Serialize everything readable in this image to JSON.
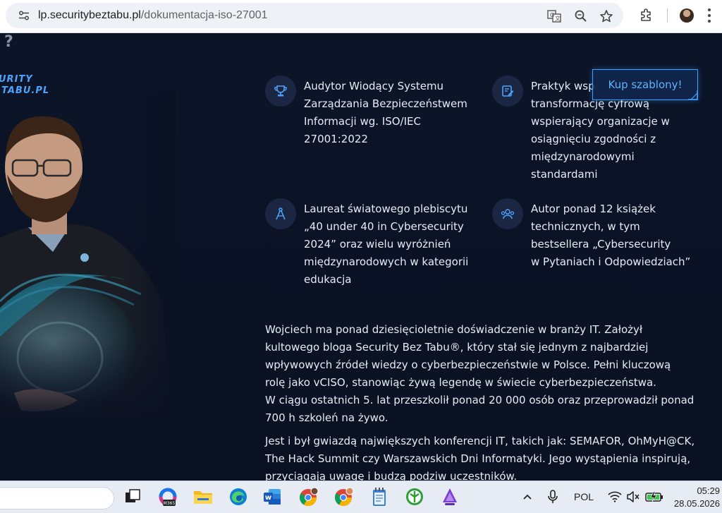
{
  "browser": {
    "url_host": "lp.securitybeztabu.pl",
    "url_path": "/dokumentacja-iso-27001",
    "icons": [
      "site-info-icon",
      "translate-icon",
      "zoom-icon",
      "bookmark-star-icon",
      "extensions-icon",
      "profile-avatar",
      "menu-kebab-icon"
    ]
  },
  "page": {
    "brand_line1": "URITY",
    "brand_line2": "TABU.PL",
    "cta_label": "Kup szablony!",
    "features": [
      {
        "icon": "trophy-icon",
        "text": "Audytor Wiodący Systemu\nZarządzania Bezpieczeństwem\nInformacji wg. ISO/IEC\n27001:2022"
      },
      {
        "icon": "document-edit-icon",
        "text": "Praktyk wsp\ntransformację cyfrową\nwspierający organizacje w\nosiągnięciu zgodności z\nmiędzynarodowymi\nstandardami"
      },
      {
        "icon": "compass-icon",
        "text": "Laureat światowego plebiscytu\n„40 under 40 in Cybersecurity\n2024” oraz wielu wyróżnień\nmiędzynarodowych w kategorii\nedukacja"
      },
      {
        "icon": "users-icon",
        "text": "Autor ponad 12 książek\ntechnicznych, w tym\nbestsellera „Cybersecurity\nw Pytaniach i Odpowiedziach”"
      }
    ],
    "paragraph1": "Wojciech ma ponad dziesięcioletnie doświadczenie w branży IT. Założył\nkultowego bloga Security Bez Tabu®, który stał się jednym z najbardziej\nwpływowych źródeł wiedzy o cyberbezpieczeństwie w Polsce. Pełni kluczową\nrolę jako vCISO, stanowiąc żywą legendę w świecie cyberbezpieczeństwa.\nW ciągu ostatnich 5. lat przeszkolił ponad 20 000 osób oraz przeprowadził ponad\n700 h szkoleń na żywo.",
    "paragraph2": "Jest i był gwiazdą największych konferencji IT, takich jak: SEMAFOR, OhMyH@CK,\nThe Hack Summit czy Warszawskich Dni Informatyki. Jego wystąpienia inspirują,\nprzyciągają uwagę i budzą podziw uczestników."
  },
  "taskbar": {
    "apps": [
      "task-view",
      "microsoft-365",
      "file-explorer",
      "edge",
      "word",
      "chrome-profile",
      "chrome",
      "notepad",
      "app-green",
      "app-purple"
    ],
    "m365_label": "M365",
    "language": "POL",
    "time": "05:29",
    "date": "28.05.2026"
  }
}
